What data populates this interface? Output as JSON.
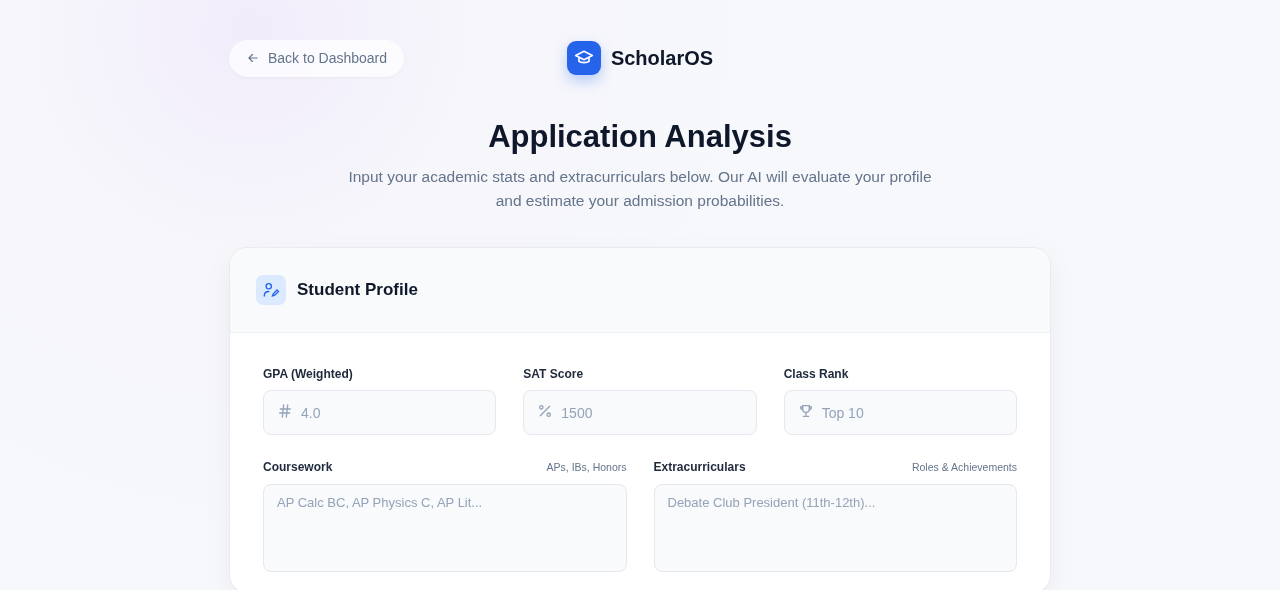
{
  "back_button": {
    "label": "Back to Dashboard"
  },
  "brand": {
    "name": "ScholarOS"
  },
  "header": {
    "title": "Application Analysis",
    "subtitle": "Input your academic stats and extracurriculars below. Our AI will evaluate your profile and estimate your admission probabilities."
  },
  "card": {
    "title": "Student Profile",
    "stat_fields": [
      {
        "label": "GPA (Weighted)",
        "placeholder": "4.0"
      },
      {
        "label": "SAT Score",
        "placeholder": "1500"
      },
      {
        "label": "Class Rank",
        "placeholder": "Top 10"
      }
    ],
    "text_areas": [
      {
        "label": "Coursework",
        "hint": "APs, IBs, Honors",
        "placeholder": "AP Calc BC, AP Physics C, AP Lit..."
      },
      {
        "label": "Extracurriculars",
        "hint": "Roles & Achievements",
        "placeholder": "Debate Club President (11th-12th)..."
      }
    ]
  }
}
